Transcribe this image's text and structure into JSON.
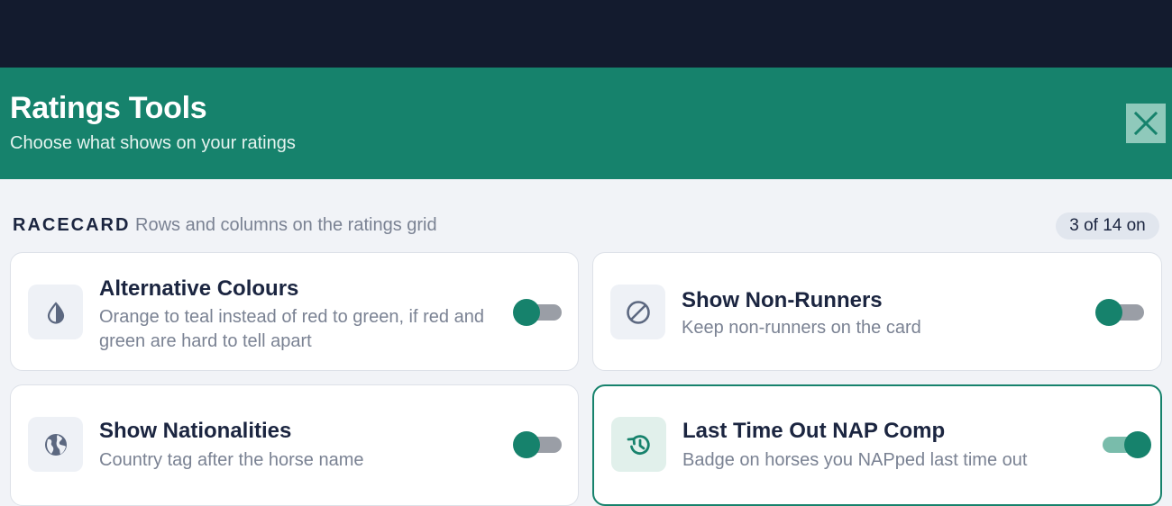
{
  "header": {
    "title": "Ratings Tools",
    "subtitle": "Choose what shows on your ratings",
    "close_icon": "close-icon"
  },
  "section": {
    "title": "RACECARD",
    "subtitle": "Rows and columns on the ratings grid",
    "count": "3 of 14 on"
  },
  "cards": [
    {
      "title": "Alternative Colours",
      "description": "Orange to teal instead of red to green, if red and green are hard to tell apart",
      "icon": "contrast-drop-icon",
      "enabled": false
    },
    {
      "title": "Show Non-Runners",
      "description": "Keep non-runners on the card",
      "icon": "prohibited-icon",
      "enabled": false
    },
    {
      "title": "Show Nationalities",
      "description": "Country tag after the horse name",
      "icon": "globe-icon",
      "enabled": false
    },
    {
      "title": "Last Time Out NAP Comp",
      "description": "Badge on horses you NAPped last time out",
      "icon": "history-icon",
      "enabled": true
    }
  ],
  "colors": {
    "brand": "#16826c",
    "topbar": "#131b2e",
    "text_dark": "#1b2540",
    "text_muted": "#7a8293"
  }
}
